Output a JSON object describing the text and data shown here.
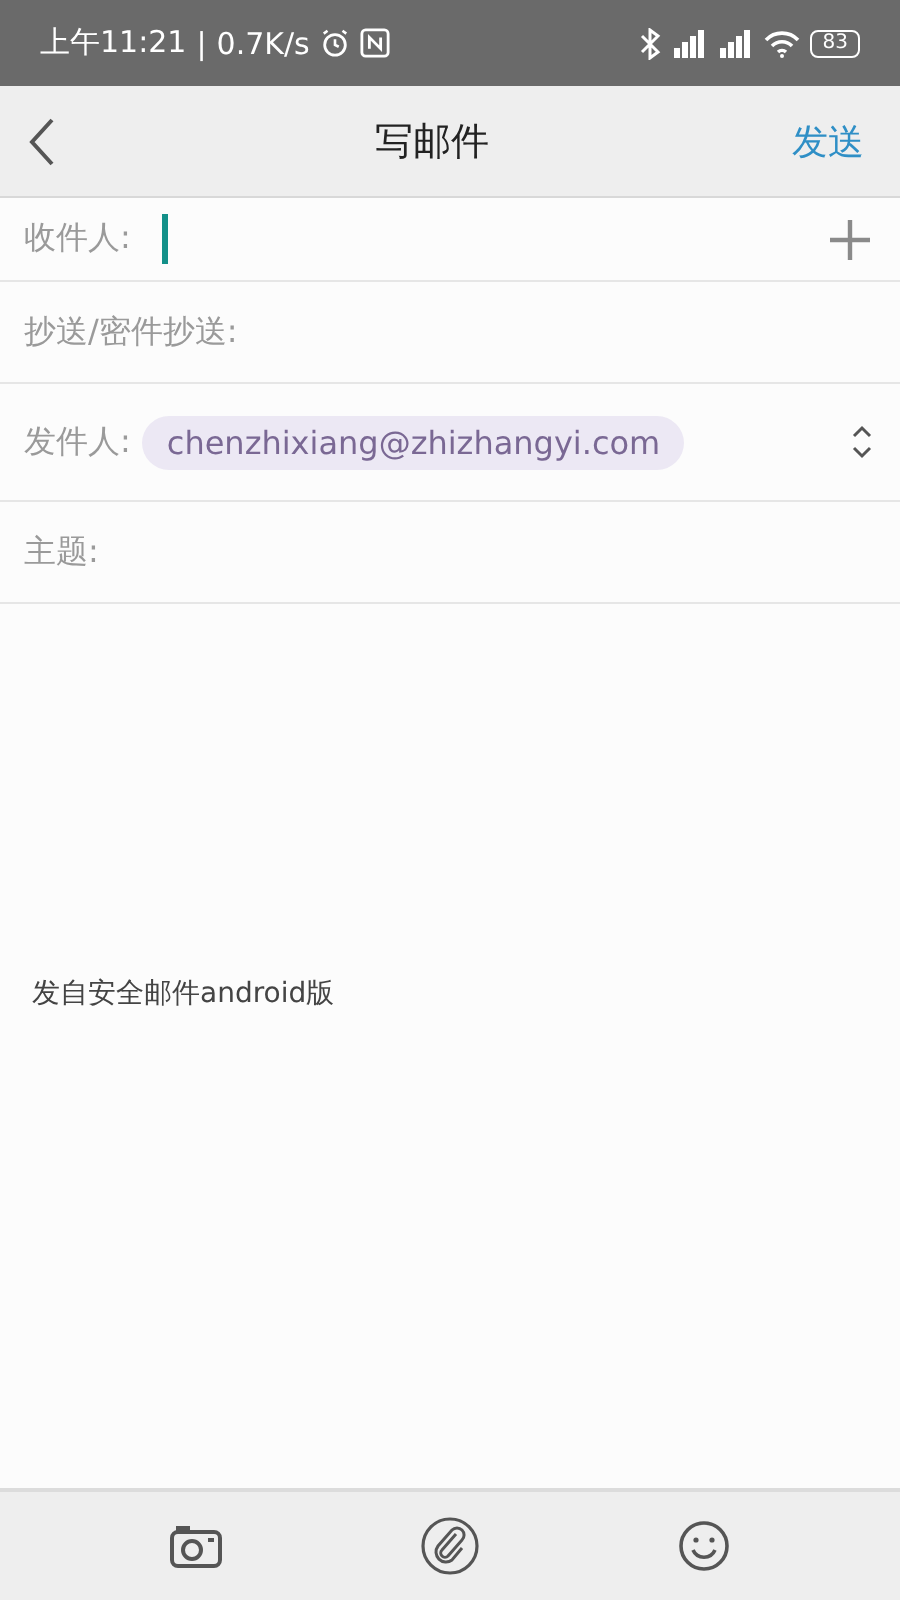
{
  "status_bar": {
    "time": "上午11:21",
    "separator": "|",
    "speed": "0.7K/s",
    "battery": "83"
  },
  "header": {
    "title": "写邮件",
    "action": "发送"
  },
  "fields": [
    {
      "kind": "recipient",
      "label": "收件人:",
      "focused": true
    },
    {
      "kind": "plain",
      "label": "抄送/密件抄送:"
    },
    {
      "kind": "sender",
      "label": "发件人:",
      "value": "chenzhixiang@zhizhangyi.com"
    },
    {
      "kind": "plain",
      "label": "主题:"
    }
  ],
  "body": {
    "signature": "发自安全邮件android版"
  },
  "toolbar": [
    {
      "kind": "camera"
    },
    {
      "kind": "attachment"
    },
    {
      "kind": "emoji"
    }
  ]
}
